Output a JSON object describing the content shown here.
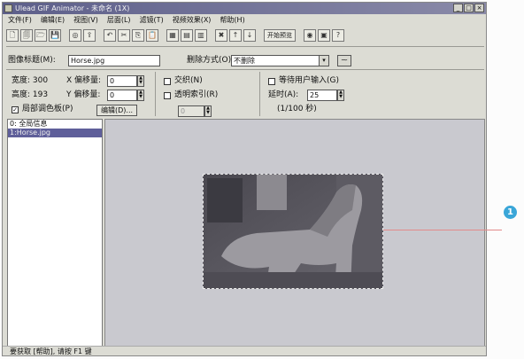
{
  "window": {
    "title": "Ulead GIF Animator - 未命名 (1X)",
    "min_label": "_",
    "max_label": "□",
    "close_label": "×"
  },
  "menu": [
    "文件(F)",
    "编辑(E)",
    "视图(V)",
    "层面(L)",
    "滤镜(T)",
    "视频效果(X)",
    "帮助(H)"
  ],
  "toolbar": {
    "icons": [
      "new-icon",
      "open-icon",
      "open-folder-icon",
      "save-icon",
      "sep",
      "optimize-icon",
      "export-icon",
      "sep",
      "undo-icon",
      "cut-icon",
      "copy-icon",
      "paste-icon",
      "sep",
      "add-image-icon",
      "add-frame-icon",
      "duplicate-frame-icon",
      "sep",
      "delete-frame-icon",
      "move-up-icon",
      "move-down-icon"
    ],
    "glyphs": [
      "🗋",
      "🗐",
      "🗁",
      "💾",
      "",
      "◎",
      "⇪",
      "",
      "↶",
      "✂",
      "⎘",
      "📋",
      "",
      "▦",
      "▤",
      "▥",
      "",
      "✖",
      "↑",
      "↓"
    ],
    "preview_label": "开始预览",
    "right_icons": [
      "color-palette-icon",
      "image-icon",
      "help-pointer-icon"
    ],
    "right_glyphs": [
      "◉",
      "▣",
      "?"
    ]
  },
  "image_title": {
    "label": "图像标题(M):",
    "value": "Horse.jpg"
  },
  "removal": {
    "label": "删除方式(O):",
    "value": "不删除",
    "dropdown_glyph": "▾",
    "btn_glyph": "⁓"
  },
  "size": {
    "width_label": "宽度: 300",
    "x_offset_label": "X 偏移量:",
    "x_offset": "0",
    "height_label": "高度: 193",
    "y_offset_label": "Y 偏移量:",
    "y_offset": "0",
    "local_palette_label": "局部调色板(P)",
    "local_palette_checked": "✓",
    "edit_button": "编辑(D)..."
  },
  "options": {
    "interlace_label": "交织(N)",
    "transparent_label": "透明索引(R)",
    "index_value": "0"
  },
  "timing": {
    "wait_user_label": "等待用户输入(G)",
    "delay_label": "延时(A):",
    "delay_value": "25",
    "unit": "(1/100 秒)"
  },
  "spin_up": "▲",
  "spin_down": "▼",
  "frames": [
    {
      "label": "0: 全局信息",
      "selected": false
    },
    {
      "label": "1:Horse.jpg",
      "selected": true
    }
  ],
  "statusbar": "要获取 [帮助], 请按 F1 键",
  "callout": "1"
}
